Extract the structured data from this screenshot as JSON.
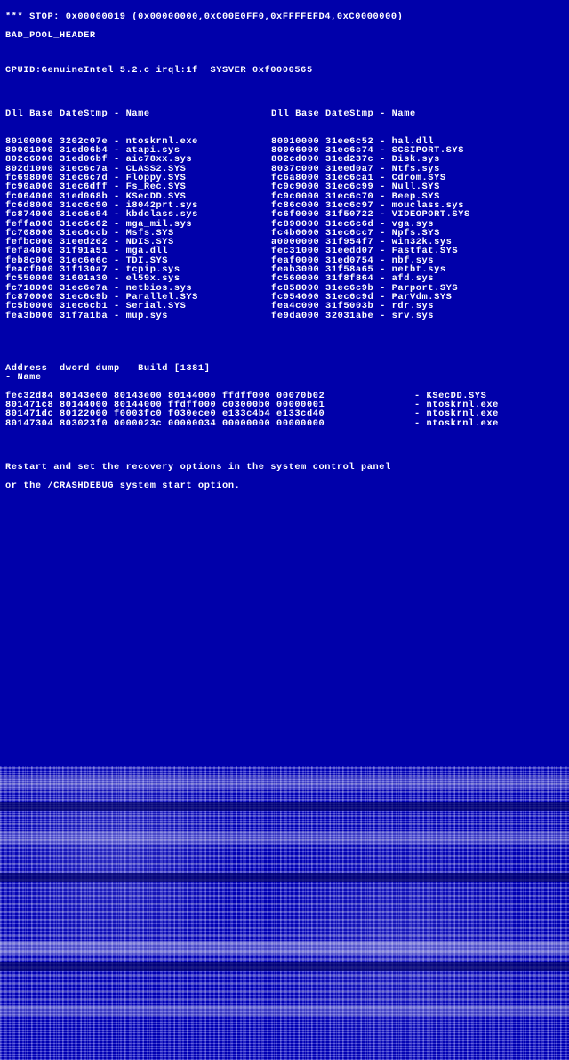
{
  "stop_line": "*** STOP: 0x00000019 (0x00000000,0xC00E0FF0,0xFFFFEFD4,0xC0000000)",
  "bad_header": "BAD_POOL_HEADER",
  "cpuid_line": "CPUID:GenuineIntel 5.2.c irql:1f  SYSVER 0xf0000565",
  "dll_header_left": "Dll Base DateStmp - Name",
  "dll_header_right": "Dll Base DateStmp - Name",
  "dll_rows": [
    {
      "L": "80100000 3202c07e - ntoskrnl.exe",
      "R": "80010000 31ee6c52 - hal.dll"
    },
    {
      "L": "80001000 31ed06b4 - atapi.sys",
      "R": "80006000 31ec6c74 - SCSIPORT.SYS"
    },
    {
      "L": "802c6000 31ed06bf - aic78xx.sys",
      "R": "802cd000 31ed237c - Disk.sys"
    },
    {
      "L": "802d1000 31ec6c7a - CLASS2.SYS",
      "R": "8037c000 31eed0a7 - Ntfs.sys"
    },
    {
      "L": "fc698000 31ec6c7d - Floppy.SYS",
      "R": "fc6a8000 31ec6ca1 - Cdrom.SYS"
    },
    {
      "L": "fc90a000 31ec6dff - Fs_Rec.SYS",
      "R": "fc9c9000 31ec6c99 - Null.SYS"
    },
    {
      "L": "fc064000 31ed068b - KSecDD.SYS",
      "R": "fc9c0000 31ec6c70 - Beep.SYS"
    },
    {
      "L": "fc6d8000 31ec6c90 - i8042prt.sys",
      "R": "fc86c000 31ec6c97 - mouclass.sys"
    },
    {
      "L": "fc874000 31ec6c94 - kbdclass.sys",
      "R": "fc6f0000 31f50722 - VIDEOPORT.SYS"
    },
    {
      "L": "feffa000 31ec6c62 - mga_mil.sys",
      "R": "fc890000 31ec6c6d - vga.sys"
    },
    {
      "L": "fc708000 31ec6ccb - Msfs.SYS",
      "R": "fc4b0000 31ec6cc7 - Npfs.SYS"
    },
    {
      "L": "fefbc000 31eed262 - NDIS.SYS",
      "R": "a0000000 31f954f7 - win32k.sys"
    },
    {
      "L": "fefa4000 31f91a51 - mga.dll",
      "R": "fec31000 31eedd07 - Fastfat.SYS"
    },
    {
      "L": "feb8c000 31ec6e6c - TDI.SYS",
      "R": "feaf0000 31ed0754 - nbf.sys"
    },
    {
      "L": "feacf000 31f130a7 - tcpip.sys",
      "R": "feab3000 31f58a65 - netbt.sys"
    },
    {
      "L": "fc550000 31601a30 - el59x.sys",
      "R": "fc560000 31f8f864 - afd.sys"
    },
    {
      "L": "fc718000 31ec6e7a - netbios.sys",
      "R": "fc858000 31ec6c9b - Parport.SYS"
    },
    {
      "L": "fc870000 31ec6c9b - Parallel.SYS",
      "R": "fc954000 31ec6c9d - ParVdm.SYS"
    },
    {
      "L": "fc5b0000 31ec6cb1 - Serial.SYS",
      "R": "fea4c000 31f5003b - rdr.sys"
    },
    {
      "L": "fea3b000 31f7a1ba - mup.sys",
      "R": "fe9da000 32031abe - srv.sys"
    }
  ],
  "addr_header_left": "Address  dword dump   Build [1381]",
  "addr_header_right": "- Name",
  "addr_rows": [
    {
      "L": "fec32d84 80143e00 80143e00 80144000 ffdff000 00070b02",
      "R": "- KSecDD.SYS"
    },
    {
      "L": "801471c8 80144000 80144000 ffdff000 c03000b0 00000001",
      "R": "- ntoskrnl.exe"
    },
    {
      "L": "801471dc 80122000 f0003fc0 f030ece0 e133c4b4 e133cd40",
      "R": "- ntoskrnl.exe"
    },
    {
      "L": "80147304 803023f0 0000023c 00000034 00000000 00000000",
      "R": "- ntoskrnl.exe"
    }
  ],
  "restart_line1": "Restart and set the recovery options in the system control panel",
  "restart_line2": "or the /CRASHDEBUG system start option."
}
